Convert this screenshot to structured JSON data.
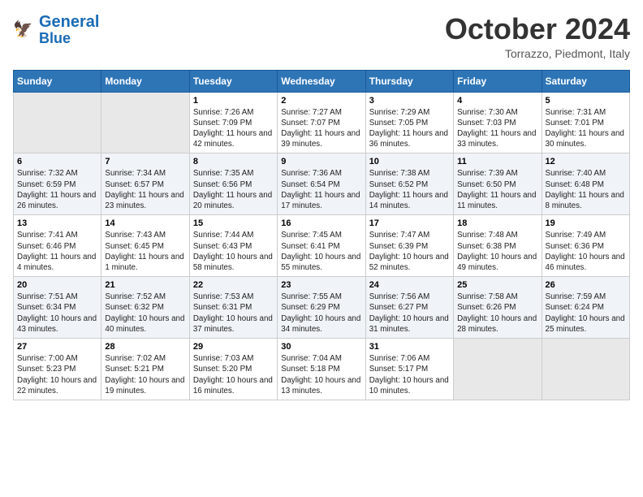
{
  "header": {
    "logo_line1": "General",
    "logo_line2": "Blue",
    "month_title": "October 2024",
    "location": "Torrazzo, Piedmont, Italy"
  },
  "days_of_week": [
    "Sunday",
    "Monday",
    "Tuesday",
    "Wednesday",
    "Thursday",
    "Friday",
    "Saturday"
  ],
  "weeks": [
    [
      {
        "day": "",
        "sunrise": "",
        "sunset": "",
        "daylight": ""
      },
      {
        "day": "",
        "sunrise": "",
        "sunset": "",
        "daylight": ""
      },
      {
        "day": "1",
        "sunrise": "Sunrise: 7:26 AM",
        "sunset": "Sunset: 7:09 PM",
        "daylight": "Daylight: 11 hours and 42 minutes."
      },
      {
        "day": "2",
        "sunrise": "Sunrise: 7:27 AM",
        "sunset": "Sunset: 7:07 PM",
        "daylight": "Daylight: 11 hours and 39 minutes."
      },
      {
        "day": "3",
        "sunrise": "Sunrise: 7:29 AM",
        "sunset": "Sunset: 7:05 PM",
        "daylight": "Daylight: 11 hours and 36 minutes."
      },
      {
        "day": "4",
        "sunrise": "Sunrise: 7:30 AM",
        "sunset": "Sunset: 7:03 PM",
        "daylight": "Daylight: 11 hours and 33 minutes."
      },
      {
        "day": "5",
        "sunrise": "Sunrise: 7:31 AM",
        "sunset": "Sunset: 7:01 PM",
        "daylight": "Daylight: 11 hours and 30 minutes."
      }
    ],
    [
      {
        "day": "6",
        "sunrise": "Sunrise: 7:32 AM",
        "sunset": "Sunset: 6:59 PM",
        "daylight": "Daylight: 11 hours and 26 minutes."
      },
      {
        "day": "7",
        "sunrise": "Sunrise: 7:34 AM",
        "sunset": "Sunset: 6:57 PM",
        "daylight": "Daylight: 11 hours and 23 minutes."
      },
      {
        "day": "8",
        "sunrise": "Sunrise: 7:35 AM",
        "sunset": "Sunset: 6:56 PM",
        "daylight": "Daylight: 11 hours and 20 minutes."
      },
      {
        "day": "9",
        "sunrise": "Sunrise: 7:36 AM",
        "sunset": "Sunset: 6:54 PM",
        "daylight": "Daylight: 11 hours and 17 minutes."
      },
      {
        "day": "10",
        "sunrise": "Sunrise: 7:38 AM",
        "sunset": "Sunset: 6:52 PM",
        "daylight": "Daylight: 11 hours and 14 minutes."
      },
      {
        "day": "11",
        "sunrise": "Sunrise: 7:39 AM",
        "sunset": "Sunset: 6:50 PM",
        "daylight": "Daylight: 11 hours and 11 minutes."
      },
      {
        "day": "12",
        "sunrise": "Sunrise: 7:40 AM",
        "sunset": "Sunset: 6:48 PM",
        "daylight": "Daylight: 11 hours and 8 minutes."
      }
    ],
    [
      {
        "day": "13",
        "sunrise": "Sunrise: 7:41 AM",
        "sunset": "Sunset: 6:46 PM",
        "daylight": "Daylight: 11 hours and 4 minutes."
      },
      {
        "day": "14",
        "sunrise": "Sunrise: 7:43 AM",
        "sunset": "Sunset: 6:45 PM",
        "daylight": "Daylight: 11 hours and 1 minute."
      },
      {
        "day": "15",
        "sunrise": "Sunrise: 7:44 AM",
        "sunset": "Sunset: 6:43 PM",
        "daylight": "Daylight: 10 hours and 58 minutes."
      },
      {
        "day": "16",
        "sunrise": "Sunrise: 7:45 AM",
        "sunset": "Sunset: 6:41 PM",
        "daylight": "Daylight: 10 hours and 55 minutes."
      },
      {
        "day": "17",
        "sunrise": "Sunrise: 7:47 AM",
        "sunset": "Sunset: 6:39 PM",
        "daylight": "Daylight: 10 hours and 52 minutes."
      },
      {
        "day": "18",
        "sunrise": "Sunrise: 7:48 AM",
        "sunset": "Sunset: 6:38 PM",
        "daylight": "Daylight: 10 hours and 49 minutes."
      },
      {
        "day": "19",
        "sunrise": "Sunrise: 7:49 AM",
        "sunset": "Sunset: 6:36 PM",
        "daylight": "Daylight: 10 hours and 46 minutes."
      }
    ],
    [
      {
        "day": "20",
        "sunrise": "Sunrise: 7:51 AM",
        "sunset": "Sunset: 6:34 PM",
        "daylight": "Daylight: 10 hours and 43 minutes."
      },
      {
        "day": "21",
        "sunrise": "Sunrise: 7:52 AM",
        "sunset": "Sunset: 6:32 PM",
        "daylight": "Daylight: 10 hours and 40 minutes."
      },
      {
        "day": "22",
        "sunrise": "Sunrise: 7:53 AM",
        "sunset": "Sunset: 6:31 PM",
        "daylight": "Daylight: 10 hours and 37 minutes."
      },
      {
        "day": "23",
        "sunrise": "Sunrise: 7:55 AM",
        "sunset": "Sunset: 6:29 PM",
        "daylight": "Daylight: 10 hours and 34 minutes."
      },
      {
        "day": "24",
        "sunrise": "Sunrise: 7:56 AM",
        "sunset": "Sunset: 6:27 PM",
        "daylight": "Daylight: 10 hours and 31 minutes."
      },
      {
        "day": "25",
        "sunrise": "Sunrise: 7:58 AM",
        "sunset": "Sunset: 6:26 PM",
        "daylight": "Daylight: 10 hours and 28 minutes."
      },
      {
        "day": "26",
        "sunrise": "Sunrise: 7:59 AM",
        "sunset": "Sunset: 6:24 PM",
        "daylight": "Daylight: 10 hours and 25 minutes."
      }
    ],
    [
      {
        "day": "27",
        "sunrise": "Sunrise: 7:00 AM",
        "sunset": "Sunset: 5:23 PM",
        "daylight": "Daylight: 10 hours and 22 minutes."
      },
      {
        "day": "28",
        "sunrise": "Sunrise: 7:02 AM",
        "sunset": "Sunset: 5:21 PM",
        "daylight": "Daylight: 10 hours and 19 minutes."
      },
      {
        "day": "29",
        "sunrise": "Sunrise: 7:03 AM",
        "sunset": "Sunset: 5:20 PM",
        "daylight": "Daylight: 10 hours and 16 minutes."
      },
      {
        "day": "30",
        "sunrise": "Sunrise: 7:04 AM",
        "sunset": "Sunset: 5:18 PM",
        "daylight": "Daylight: 10 hours and 13 minutes."
      },
      {
        "day": "31",
        "sunrise": "Sunrise: 7:06 AM",
        "sunset": "Sunset: 5:17 PM",
        "daylight": "Daylight: 10 hours and 10 minutes."
      },
      {
        "day": "",
        "sunrise": "",
        "sunset": "",
        "daylight": ""
      },
      {
        "day": "",
        "sunrise": "",
        "sunset": "",
        "daylight": ""
      }
    ]
  ]
}
